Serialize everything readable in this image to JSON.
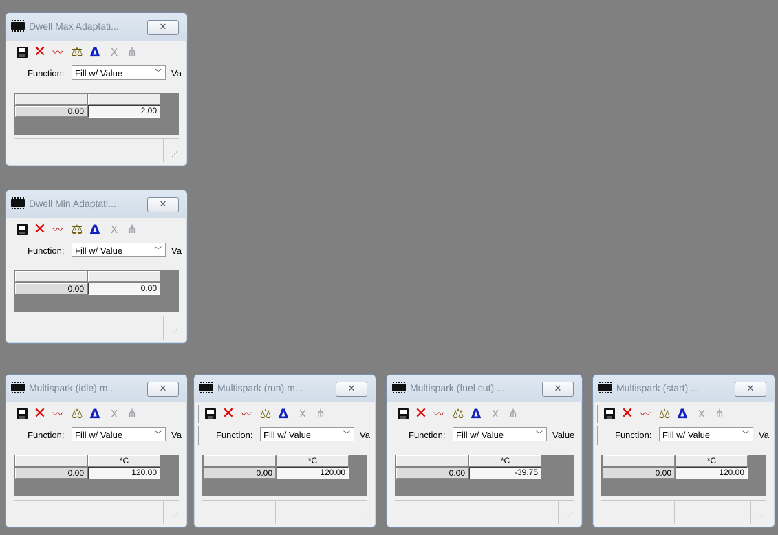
{
  "windows": [
    {
      "title": "Dwell Max Adaptati...",
      "close_label": "✕",
      "function_label": "Function:",
      "function_value": "Fill w/ Value",
      "trailing_label": "Va",
      "header_left": "",
      "header_right": "",
      "value_left": "0.00",
      "value_right": "2.00"
    },
    {
      "title": "Dwell Min Adaptati...",
      "close_label": "✕",
      "function_label": "Function:",
      "function_value": "Fill w/ Value",
      "trailing_label": "Va",
      "header_left": "",
      "header_right": "",
      "value_left": "0.00",
      "value_right": "0.00"
    },
    {
      "title": "Multispark (idle) m...",
      "close_label": "✕",
      "function_label": "Function:",
      "function_value": "Fill w/ Value",
      "trailing_label": "Va",
      "header_left": "",
      "header_right": "*C",
      "value_left": "0.00",
      "value_right": "120.00"
    },
    {
      "title": "Multispark (run) m...",
      "close_label": "✕",
      "function_label": "Function:",
      "function_value": "Fill w/ Value",
      "trailing_label": "Va",
      "header_left": "",
      "header_right": "*C",
      "value_left": "0.00",
      "value_right": "120.00"
    },
    {
      "title": "Multispark (fuel cut) ...",
      "close_label": "✕",
      "function_label": "Function:",
      "function_value": "Fill w/ Value",
      "trailing_label": "Value",
      "header_left": "",
      "header_right": "*C",
      "value_left": "0.00",
      "value_right": "-39.75"
    },
    {
      "title": "Multispark (start) ...",
      "close_label": "✕",
      "function_label": "Function:",
      "function_value": "Fill w/ Value",
      "trailing_label": "Va",
      "header_left": "",
      "header_right": "*C",
      "value_left": "0.00",
      "value_right": "120.00"
    }
  ],
  "toolbar_icons": {
    "x": "✕",
    "chart": "〰",
    "scale": "⚖",
    "delta": "Δ",
    "xgrey": "X",
    "fork": "⋔"
  },
  "colors": {
    "desktop": "#808080",
    "delete_red": "#e00000",
    "delta_blue": "#1020c0"
  }
}
